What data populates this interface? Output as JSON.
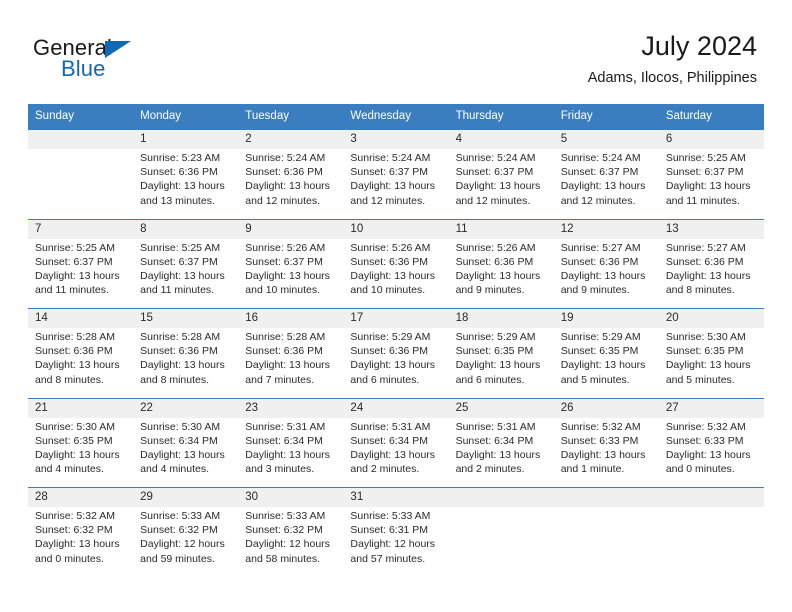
{
  "brand": {
    "word_one": "General",
    "word_two": "Blue",
    "triangle_icon": "triangle-logo-icon",
    "accent_color": "#1268b3"
  },
  "header": {
    "title": "July 2024",
    "location": "Adams, Ilocos, Philippines"
  },
  "theme": {
    "header_blue": "#3a7ebf",
    "band_gray": "#f0f0f0",
    "text_dark": "#2b2b2b"
  },
  "calendar": {
    "weekday_headers": [
      "Sunday",
      "Monday",
      "Tuesday",
      "Wednesday",
      "Thursday",
      "Friday",
      "Saturday"
    ],
    "labels": {
      "sunrise": "Sunrise:",
      "sunset": "Sunset:",
      "daylight": "Daylight:"
    },
    "weeks": [
      [
        {
          "day": "",
          "lines": [
            "",
            "",
            "",
            ""
          ]
        },
        {
          "day": "1",
          "lines": [
            "Sunrise: 5:23 AM",
            "Sunset: 6:36 PM",
            "Daylight: 13 hours",
            "and 13 minutes."
          ]
        },
        {
          "day": "2",
          "lines": [
            "Sunrise: 5:24 AM",
            "Sunset: 6:36 PM",
            "Daylight: 13 hours",
            "and 12 minutes."
          ]
        },
        {
          "day": "3",
          "lines": [
            "Sunrise: 5:24 AM",
            "Sunset: 6:37 PM",
            "Daylight: 13 hours",
            "and 12 minutes."
          ]
        },
        {
          "day": "4",
          "lines": [
            "Sunrise: 5:24 AM",
            "Sunset: 6:37 PM",
            "Daylight: 13 hours",
            "and 12 minutes."
          ]
        },
        {
          "day": "5",
          "lines": [
            "Sunrise: 5:24 AM",
            "Sunset: 6:37 PM",
            "Daylight: 13 hours",
            "and 12 minutes."
          ]
        },
        {
          "day": "6",
          "lines": [
            "Sunrise: 5:25 AM",
            "Sunset: 6:37 PM",
            "Daylight: 13 hours",
            "and 11 minutes."
          ]
        }
      ],
      [
        {
          "day": "7",
          "lines": [
            "Sunrise: 5:25 AM",
            "Sunset: 6:37 PM",
            "Daylight: 13 hours",
            "and 11 minutes."
          ]
        },
        {
          "day": "8",
          "lines": [
            "Sunrise: 5:25 AM",
            "Sunset: 6:37 PM",
            "Daylight: 13 hours",
            "and 11 minutes."
          ]
        },
        {
          "day": "9",
          "lines": [
            "Sunrise: 5:26 AM",
            "Sunset: 6:37 PM",
            "Daylight: 13 hours",
            "and 10 minutes."
          ]
        },
        {
          "day": "10",
          "lines": [
            "Sunrise: 5:26 AM",
            "Sunset: 6:36 PM",
            "Daylight: 13 hours",
            "and 10 minutes."
          ]
        },
        {
          "day": "11",
          "lines": [
            "Sunrise: 5:26 AM",
            "Sunset: 6:36 PM",
            "Daylight: 13 hours",
            "and 9 minutes."
          ]
        },
        {
          "day": "12",
          "lines": [
            "Sunrise: 5:27 AM",
            "Sunset: 6:36 PM",
            "Daylight: 13 hours",
            "and 9 minutes."
          ]
        },
        {
          "day": "13",
          "lines": [
            "Sunrise: 5:27 AM",
            "Sunset: 6:36 PM",
            "Daylight: 13 hours",
            "and 8 minutes."
          ]
        }
      ],
      [
        {
          "day": "14",
          "lines": [
            "Sunrise: 5:28 AM",
            "Sunset: 6:36 PM",
            "Daylight: 13 hours",
            "and 8 minutes."
          ]
        },
        {
          "day": "15",
          "lines": [
            "Sunrise: 5:28 AM",
            "Sunset: 6:36 PM",
            "Daylight: 13 hours",
            "and 8 minutes."
          ]
        },
        {
          "day": "16",
          "lines": [
            "Sunrise: 5:28 AM",
            "Sunset: 6:36 PM",
            "Daylight: 13 hours",
            "and 7 minutes."
          ]
        },
        {
          "day": "17",
          "lines": [
            "Sunrise: 5:29 AM",
            "Sunset: 6:36 PM",
            "Daylight: 13 hours",
            "and 6 minutes."
          ]
        },
        {
          "day": "18",
          "lines": [
            "Sunrise: 5:29 AM",
            "Sunset: 6:35 PM",
            "Daylight: 13 hours",
            "and 6 minutes."
          ]
        },
        {
          "day": "19",
          "lines": [
            "Sunrise: 5:29 AM",
            "Sunset: 6:35 PM",
            "Daylight: 13 hours",
            "and 5 minutes."
          ]
        },
        {
          "day": "20",
          "lines": [
            "Sunrise: 5:30 AM",
            "Sunset: 6:35 PM",
            "Daylight: 13 hours",
            "and 5 minutes."
          ]
        }
      ],
      [
        {
          "day": "21",
          "lines": [
            "Sunrise: 5:30 AM",
            "Sunset: 6:35 PM",
            "Daylight: 13 hours",
            "and 4 minutes."
          ]
        },
        {
          "day": "22",
          "lines": [
            "Sunrise: 5:30 AM",
            "Sunset: 6:34 PM",
            "Daylight: 13 hours",
            "and 4 minutes."
          ]
        },
        {
          "day": "23",
          "lines": [
            "Sunrise: 5:31 AM",
            "Sunset: 6:34 PM",
            "Daylight: 13 hours",
            "and 3 minutes."
          ]
        },
        {
          "day": "24",
          "lines": [
            "Sunrise: 5:31 AM",
            "Sunset: 6:34 PM",
            "Daylight: 13 hours",
            "and 2 minutes."
          ]
        },
        {
          "day": "25",
          "lines": [
            "Sunrise: 5:31 AM",
            "Sunset: 6:34 PM",
            "Daylight: 13 hours",
            "and 2 minutes."
          ]
        },
        {
          "day": "26",
          "lines": [
            "Sunrise: 5:32 AM",
            "Sunset: 6:33 PM",
            "Daylight: 13 hours",
            "and 1 minute."
          ]
        },
        {
          "day": "27",
          "lines": [
            "Sunrise: 5:32 AM",
            "Sunset: 6:33 PM",
            "Daylight: 13 hours",
            "and 0 minutes."
          ]
        }
      ],
      [
        {
          "day": "28",
          "lines": [
            "Sunrise: 5:32 AM",
            "Sunset: 6:32 PM",
            "Daylight: 13 hours",
            "and 0 minutes."
          ]
        },
        {
          "day": "29",
          "lines": [
            "Sunrise: 5:33 AM",
            "Sunset: 6:32 PM",
            "Daylight: 12 hours",
            "and 59 minutes."
          ]
        },
        {
          "day": "30",
          "lines": [
            "Sunrise: 5:33 AM",
            "Sunset: 6:32 PM",
            "Daylight: 12 hours",
            "and 58 minutes."
          ]
        },
        {
          "day": "31",
          "lines": [
            "Sunrise: 5:33 AM",
            "Sunset: 6:31 PM",
            "Daylight: 12 hours",
            "and 57 minutes."
          ]
        },
        {
          "day": "",
          "lines": [
            "",
            "",
            "",
            ""
          ]
        },
        {
          "day": "",
          "lines": [
            "",
            "",
            "",
            ""
          ]
        },
        {
          "day": "",
          "lines": [
            "",
            "",
            "",
            ""
          ]
        }
      ]
    ]
  }
}
